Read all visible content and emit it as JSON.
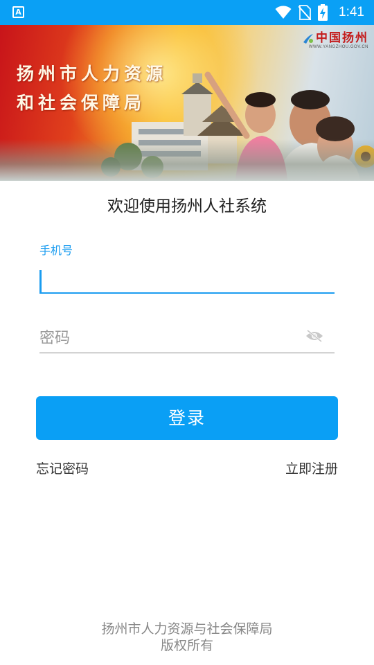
{
  "status_bar": {
    "app_icon_letter": "A",
    "time": "1:41"
  },
  "banner": {
    "title_line1": "扬州市人力资源",
    "title_line2": "和社会保障局",
    "logo_text": "中国扬州",
    "logo_url": "WWW.YANGZHOU.GOV.CN"
  },
  "welcome": "欢迎使用扬州人社系统",
  "form": {
    "phone_label": "手机号",
    "phone_value": "",
    "password_placeholder": "密码"
  },
  "login_button": "登录",
  "links": {
    "forgot": "忘记密码",
    "register": "立即注册"
  },
  "footer": {
    "line1": "扬州市人力资源与社会保障局",
    "line2": "版权所有"
  },
  "colors": {
    "accent": "#0a9ff5",
    "status_bar": "#0aa0f5"
  }
}
